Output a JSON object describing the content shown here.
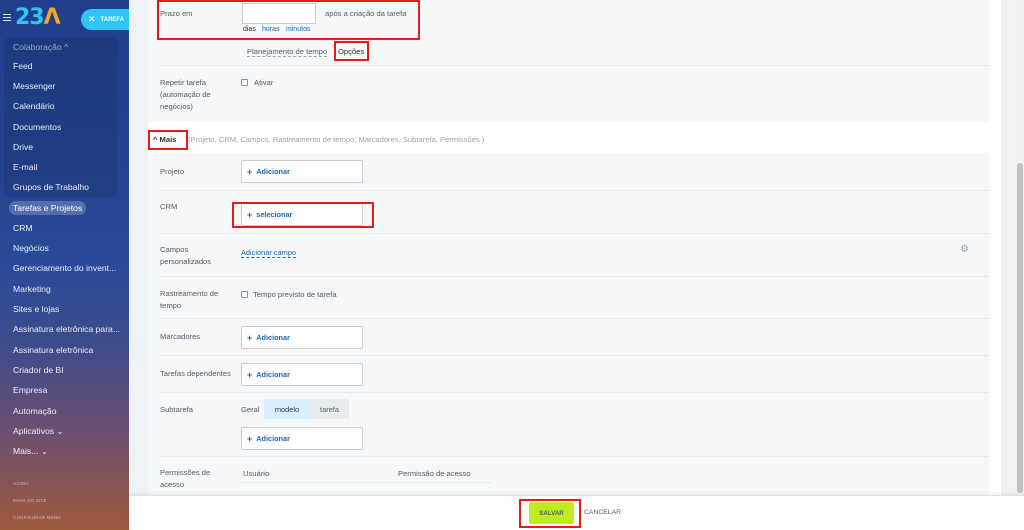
{
  "sidebar": {
    "logo": {
      "main": "23",
      "accent": "Λ"
    },
    "tab_button": {
      "label": "TAREFA"
    },
    "group_header": "Colaboração ^",
    "items": [
      {
        "label": "Feed"
      },
      {
        "label": "Messenger"
      },
      {
        "label": "Calendário"
      },
      {
        "label": "Documentos"
      },
      {
        "label": "Drive"
      },
      {
        "label": "E-mail"
      },
      {
        "label": "Grupos de Trabalho"
      },
      {
        "label": "Tarefas e Projetos"
      },
      {
        "label": "CRM"
      },
      {
        "label": "Negócios"
      },
      {
        "label": "Gerenciamento do invent..."
      },
      {
        "label": "Marketing"
      },
      {
        "label": "Sites e lojas"
      },
      {
        "label": "Assinatura eletrônica para..."
      },
      {
        "label": "Assinatura eletrônica"
      },
      {
        "label": "Criador de BI"
      },
      {
        "label": "Empresa"
      },
      {
        "label": "Automação"
      },
      {
        "label": "Aplicativos ⌄"
      },
      {
        "label": "Mais... ⌄"
      }
    ],
    "bottom_links": [
      "AJUDA",
      "MAPA DO SITE",
      "CONFIGURAR MENU"
    ]
  },
  "form": {
    "deadline": {
      "label": "Prazo em",
      "input_value": "",
      "suffix": "após a criação da tarefa",
      "units": [
        "dias",
        "horas",
        "minutos"
      ],
      "active_unit": "dias"
    },
    "options_tabs": [
      "Planejamento de tempo",
      "Opções"
    ],
    "repeat": {
      "label": "Repetir tarefa (automação de negócios)",
      "checkbox_label": "Ativar"
    },
    "more": {
      "toggle_label": "^ Mais",
      "sections": "(Projeto,  CRM,  Campos,  Rastreamento de tempo,  Marcadores,  Subtarefa,  Permissões )"
    },
    "project": {
      "label": "Projeto",
      "button": "Adicionar"
    },
    "crm": {
      "label": "CRM",
      "button": "selecionar"
    },
    "custom_fields": {
      "label": "Campos personalizados",
      "link": "Adicionar campo"
    },
    "time_tracking": {
      "label": "Rastreamento de tempo",
      "checkbox_label": "Tempo previsto de tarefa"
    },
    "tags": {
      "label": "Marcadores",
      "button": "Adicionar"
    },
    "dependent": {
      "label": "Tarefas dependentes",
      "button": "Adicionar"
    },
    "subtask": {
      "label": "Subtarefa",
      "modes": [
        "Geral",
        "modelo",
        "tarefa"
      ],
      "active_mode": "modelo",
      "button": "Adicionar"
    },
    "permissions": {
      "label": "Permissões de acesso",
      "columns": [
        "Usuário",
        "Permissão de acesso"
      ]
    }
  },
  "footer": {
    "save": "SALVAR",
    "cancel": "CANCELAR"
  },
  "colors": {
    "accent": "#2fc6f6",
    "save": "#bbed21",
    "link": "#2067b0",
    "highlight": "#e21b1b"
  }
}
